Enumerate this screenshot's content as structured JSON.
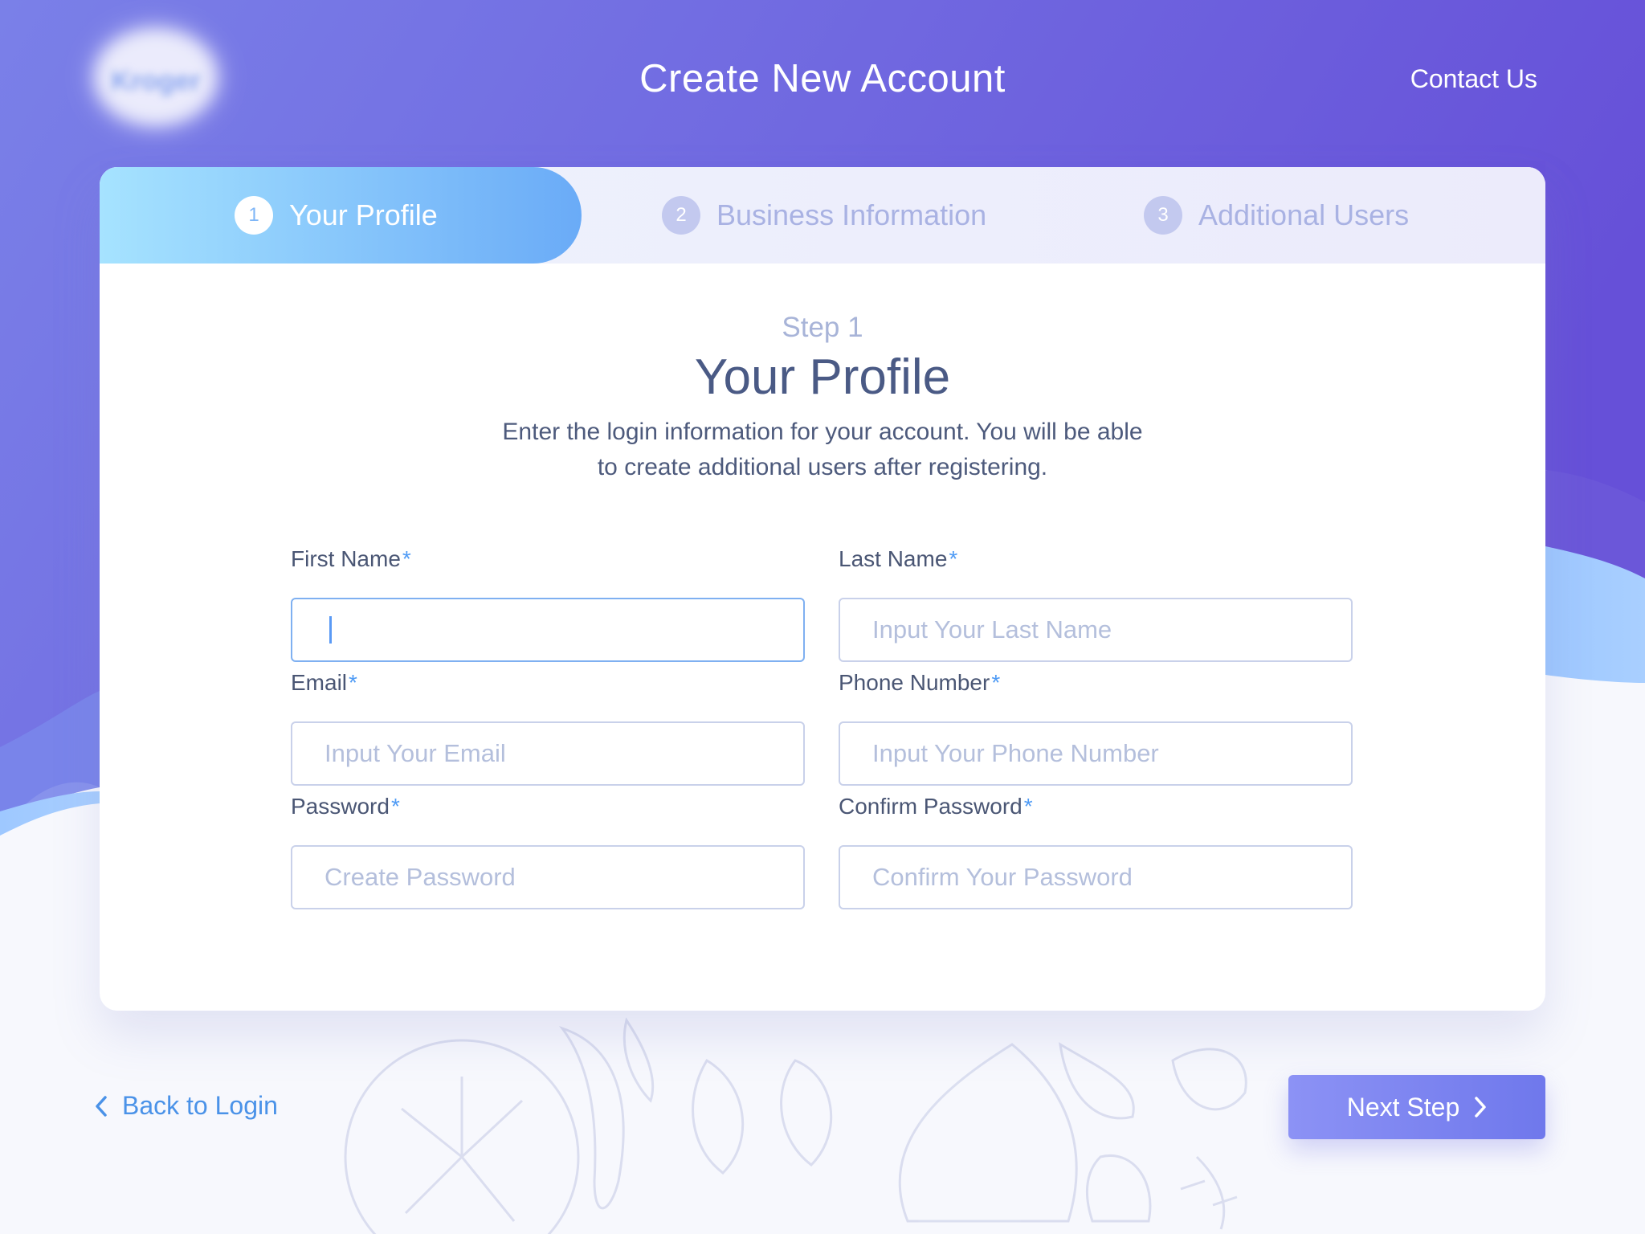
{
  "header": {
    "title": "Create New Account",
    "contact_label": "Contact Us",
    "logo_text": "Kroger"
  },
  "stepper": {
    "steps": [
      {
        "number": "1",
        "label": "Your Profile",
        "active": true
      },
      {
        "number": "2",
        "label": "Business Information",
        "active": false
      },
      {
        "number": "3",
        "label": "Additional Users",
        "active": false
      }
    ]
  },
  "form": {
    "step_caption": "Step 1",
    "title": "Your Profile",
    "description": "Enter the login information for your account. You will be able to create additional users after registering.",
    "required_mark": "*",
    "fields": {
      "first_name": {
        "label": "First Name",
        "value": "",
        "placeholder": ""
      },
      "last_name": {
        "label": "Last Name",
        "value": "",
        "placeholder": "Input Your Last Name"
      },
      "email": {
        "label": "Email",
        "value": "",
        "placeholder": "Input Your Email"
      },
      "phone": {
        "label": "Phone Number",
        "value": "",
        "placeholder": "Input Your Phone Number"
      },
      "password": {
        "label": "Password",
        "value": "",
        "placeholder": "Create Password"
      },
      "confirm_password": {
        "label": "Confirm Password",
        "value": "",
        "placeholder": "Confirm Your Password"
      }
    }
  },
  "footer": {
    "back_label": "Back to Login",
    "next_label": "Next Step"
  },
  "colors": {
    "header_gradient_start": "#7a7fe6",
    "header_gradient_end": "#6a52d6",
    "accent_blue": "#4f9bf5",
    "step_active_start": "#a6e3ff",
    "step_active_end": "#6aabf7",
    "button_gradient_start": "#8c92f5",
    "button_gradient_end": "#6f78ec"
  },
  "icons": {
    "back": "chevron-left-icon",
    "next": "chevron-right-icon"
  }
}
